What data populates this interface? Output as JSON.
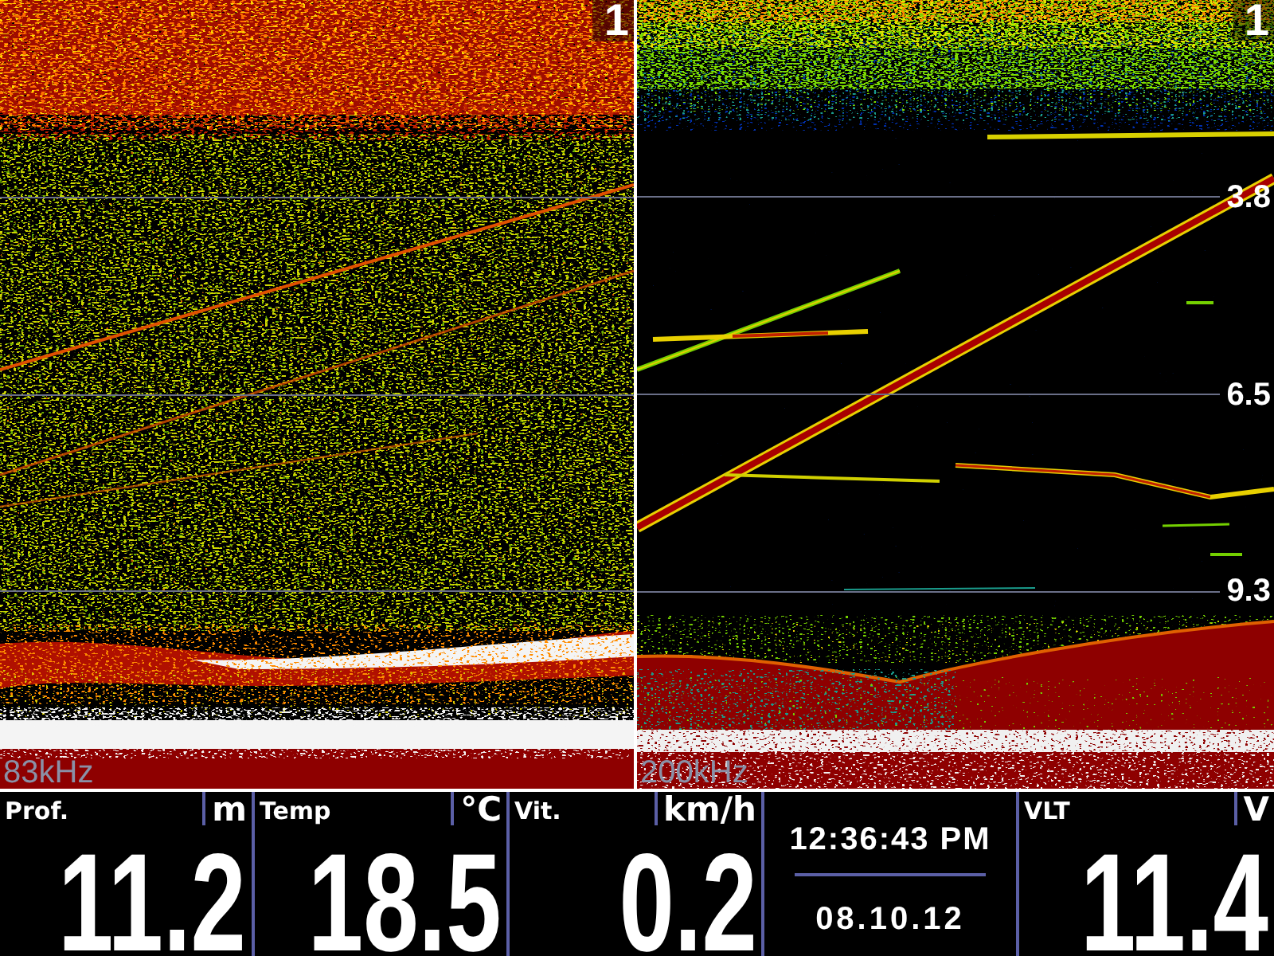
{
  "sonar_panels": [
    {
      "range_marker": "1",
      "frequency": "83kHz"
    },
    {
      "range_marker": "1",
      "depth_marks": [
        "3.8",
        "6.5",
        "9.3"
      ],
      "frequency": "200kHz"
    }
  ],
  "data_bar": [
    {
      "kind": "readout",
      "label": "Prof.",
      "unit": "m",
      "value": "11.2"
    },
    {
      "kind": "readout",
      "label": "Temp",
      "unit": "°C",
      "value": "18.5"
    },
    {
      "kind": "readout",
      "label": "Vit.",
      "unit": "km/h",
      "value": "0.2"
    },
    {
      "kind": "clock",
      "time": "12:36:43 PM",
      "date": "08.10.12"
    },
    {
      "kind": "readout",
      "label": "VLT",
      "unit": "V",
      "value": "11.4"
    }
  ]
}
